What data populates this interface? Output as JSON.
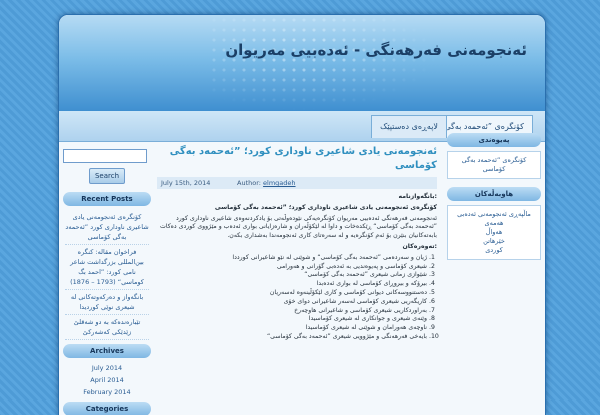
{
  "site": {
    "title": "ئەنجومەنی فەرهەنگی - ئەدەبیی مەریوان"
  },
  "nav": {
    "tabs": [
      "کۆنگرەی ”ئەحمەد بەگی",
      "لاپەڕەی دەستپێک"
    ]
  },
  "search": {
    "placeholder": "",
    "button": "Search"
  },
  "left_sidebar": {
    "recent_posts_heading": "Recent Posts",
    "recent_posts": [
      "کۆنگرەی ئەنجومەنی یادی شاعیری ناوداری کورد ”ئەحمەد بەگی کۆماسی",
      "فراخوان مقاله: کنگره بین‌المللی بزرگداشت شاعر نامی کورد: ”احمد بگ کوماسی“ (1793 – 1876)",
      "بانگەواز و دەرکەوتەکانی لە شیعری نوێی کوردیدا",
      "تێبارەندەکە بە دو شەقلێ زێدێکی کەشەرکێ"
    ],
    "archives_heading": "Archives",
    "archives": [
      "July 2014",
      "April 2014",
      "February 2014"
    ],
    "categories_heading": "Categories"
  },
  "post": {
    "title": "ئەنجومەنی یادی شاعیری ناوداری کورد؛ ”ئەحمەد بەگی کۆماسی",
    "date": "July 15th, 2014",
    "author_label": "Author:",
    "author": "elmgadeh",
    "heading_line": ":بانگەوازنامە",
    "subheading": "کۆنگرەی ئەنجومەنی یادی شاعیری ناوداری کورد؛ ”ئەحمەد بەگی کۆماسی",
    "intro": "ئەنجومەنی فەرهەنگی ئەدەبیی مەریوان کۆنگرەیەکی نێودەوڵەتی بۆ یادکردنەوەی شاعیری ناوداری کورد ”ئەحمەد بەگی کۆماسی“ ڕێکدەخات و داوا لە لێکۆڵەران و شارەزایانی بواری ئەدەب و مێژووی کوردی دەکات بابەتەکانیان بنێرن بۆ ئەم کۆنگرەیە و لە سەرەتای کاری ئەنجومەندا بەشداری بکەن.",
    "topics_label": ":تەوەرەکان",
    "topics": [
      "ژیان و سەردەمی ”ئەحمەد بەگی کۆماسی“ و شوێنی لە نێو شاعیرانی کورددا",
      "شیعری کۆماسی و پەیوەندیی بە ئەدەبی گۆرانی و هەورامی",
      "شێوازی زمانی شیعری ”ئەحمەد بەگی کۆماسی“",
      "بیرۆکە و بیروڕای کۆماسی لە بواری ئەدەبدا",
      "دەستنووسەکانی دیوانی کۆماسی و کاری لێکۆڵینەوە لەسەریان",
      "کاریگەریی شیعری کۆماسی لەسەر شاعیرانی دوای خۆی",
      "بەراوردکاریی شیعری کۆماسی و شاعیرانی هاوچەرخ",
      "وێنەی شیعری و جوانکاری لە شیعری کۆماسیدا",
      "ناوچەی هەورامان و شوێنی لە شیعری کۆماسیدا",
      "بایەخی فەرهەنگی و مێژوویی شیعری ”ئەحمەد بەگی کۆماسی“"
    ]
  },
  "right_sidebar": {
    "about_heading": "پەیوەندی",
    "about_text": "کۆنگرەی ”ئەحمەد بەگی کۆماسی",
    "links_heading": "هاوبەڵەکان",
    "links": [
      "ماڵپەڕی ئەنجومەنی ئەدەبی",
      "هەمەی",
      "هەواڵ",
      "خێرهاتن",
      "کوردی"
    ]
  }
}
